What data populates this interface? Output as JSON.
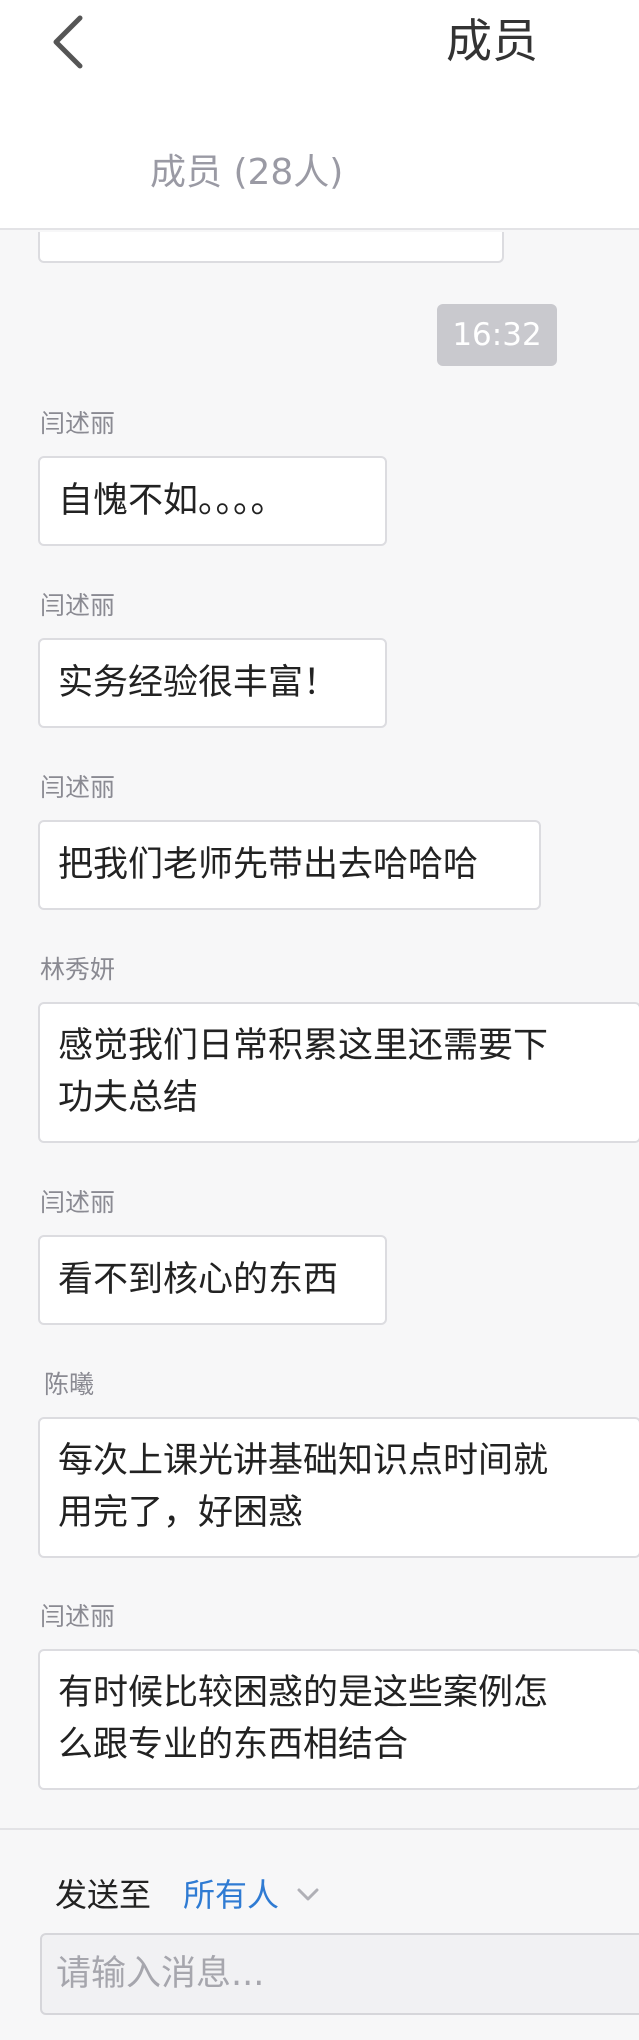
{
  "header": {
    "title": "成员",
    "members_tab": "成员 (28人)"
  },
  "chat": {
    "timestamp": "16:32",
    "messages": [
      {
        "sender": "闫述丽",
        "text": "自愧不如。。。。"
      },
      {
        "sender": "闫述丽",
        "text": "实务经验很丰富！"
      },
      {
        "sender": "闫述丽",
        "text": "把我们老师先带出去哈哈哈"
      },
      {
        "sender": "林秀妍",
        "text": "感觉我们日常积累这里还需要下\n功夫总结"
      },
      {
        "sender": "闫述丽",
        "text": "看不到核心的东西"
      },
      {
        "sender": "陈曦",
        "text": "每次上课光讲基础知识点时间就\n用完了，好困惑"
      },
      {
        "sender": "闫述丽",
        "text": "有时候比较困惑的是这些案例怎\n么跟专业的东西相结合"
      }
    ]
  },
  "composer": {
    "send_to_label": "发送至",
    "recipient": "所有人",
    "input_placeholder": "请输入消息..."
  }
}
